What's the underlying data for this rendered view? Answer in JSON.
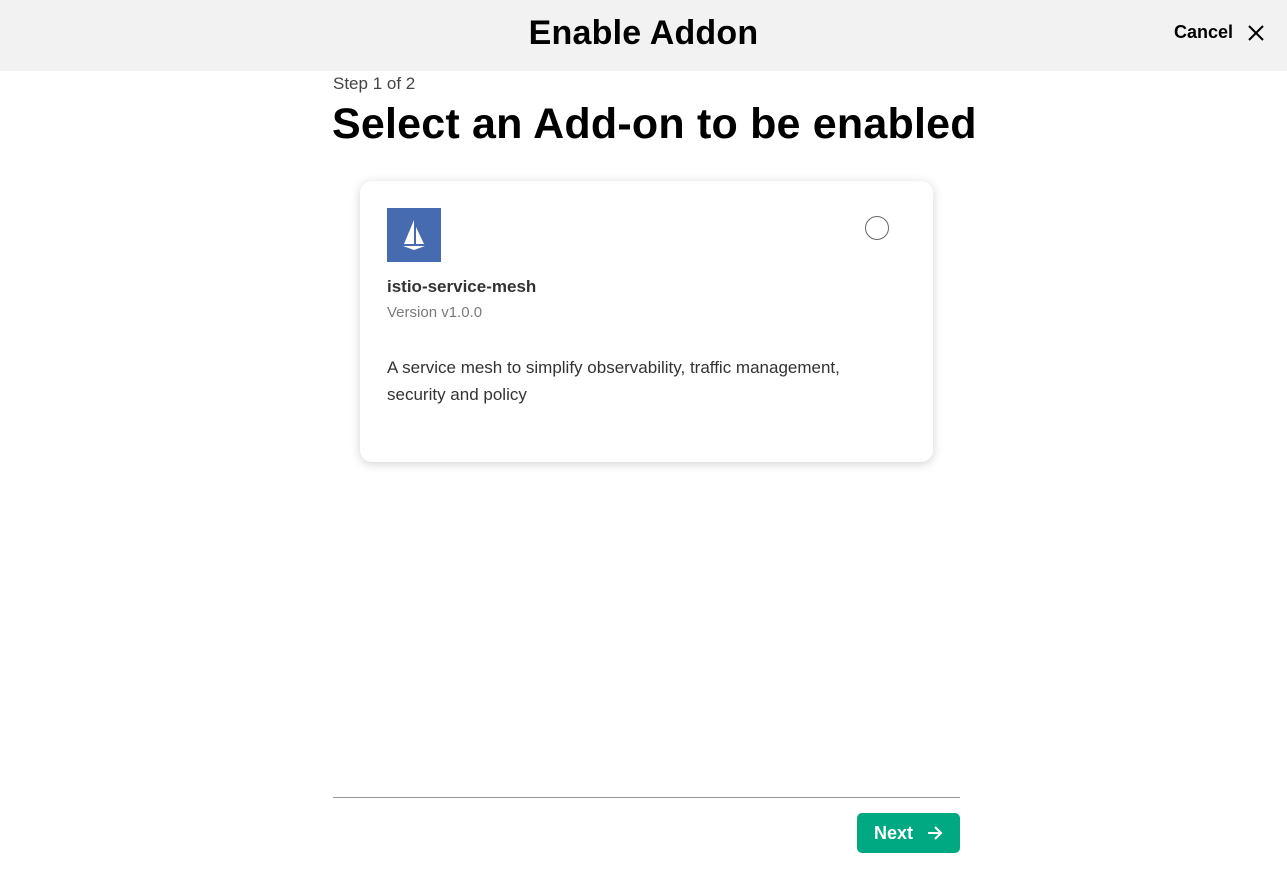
{
  "header": {
    "title": "Enable Addon",
    "cancel_label": "Cancel"
  },
  "wizard": {
    "step_text": "Step 1 of 2",
    "title": "Select an Add-on to be enabled"
  },
  "addons": [
    {
      "name": "istio-service-mesh",
      "version": "Version v1.0.0",
      "description": "A service mesh to simplify observability, traffic management, security and policy",
      "icon": "sailboat-icon",
      "selected": false,
      "logo_color": "#466bb0"
    }
  ],
  "footer": {
    "next_label": "Next"
  },
  "colors": {
    "primary_button": "#01a982",
    "header_background": "#f2f2f2"
  }
}
